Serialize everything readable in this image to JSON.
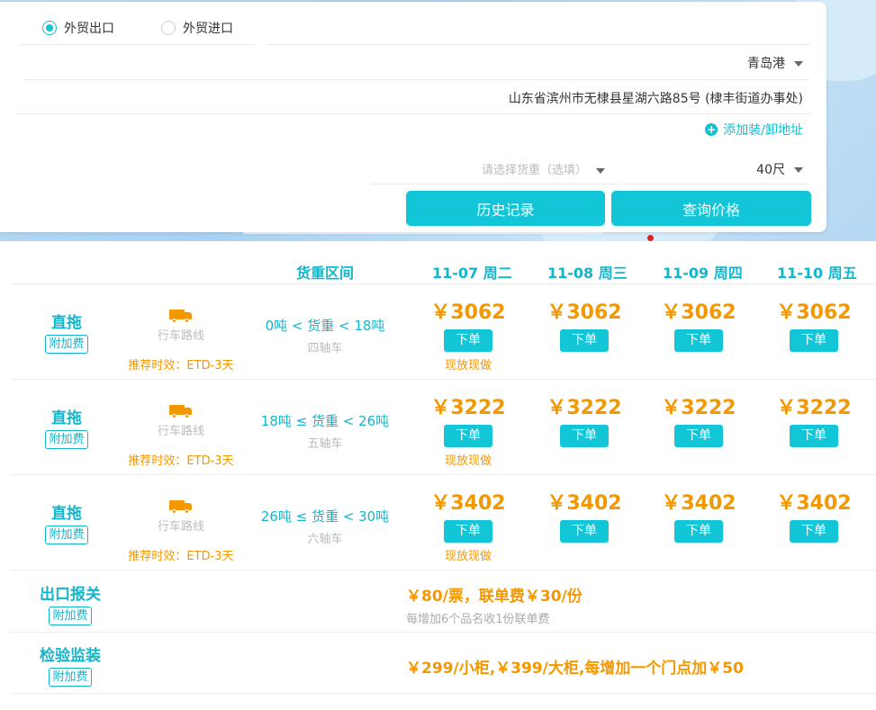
{
  "query": {
    "trade_type": [
      {
        "label": "外贸出口",
        "selected": true
      },
      {
        "label": "外贸进口",
        "selected": false
      }
    ],
    "port": "青岛港",
    "address": "山东省滨州市无棣县星湖六路85号 (棣丰街道办事处)",
    "add_address": "添加装/卸地址",
    "weight_placeholder": "请选择货重（选填）",
    "container": "40尺",
    "history_button": "历史记录",
    "search_button": "查询价格"
  },
  "table": {
    "weight_header": "货重区间",
    "dates": [
      "11-07 周二",
      "11-08 周三",
      "11-09 周四",
      "11-10 周五"
    ],
    "order_label": "下单",
    "rows": [
      {
        "service": "直拖",
        "tag": "附加费",
        "route": "行车路线",
        "eta": "推荐时效：ETD-3天",
        "weight_range": "0吨 < 货重 < 18吨",
        "axle": "四轴车",
        "prices": [
          "￥3062",
          "￥3062",
          "￥3062",
          "￥3062"
        ],
        "note": "现放现做"
      },
      {
        "service": "直拖",
        "tag": "附加费",
        "route": "行车路线",
        "eta": "推荐时效：ETD-3天",
        "weight_range": "18吨 ≤ 货重 < 26吨",
        "axle": "五轴车",
        "prices": [
          "￥3222",
          "￥3222",
          "￥3222",
          "￥3222"
        ],
        "note": "现放现做"
      },
      {
        "service": "直拖",
        "tag": "附加费",
        "route": "行车路线",
        "eta": "推荐时效：ETD-3天",
        "weight_range": "26吨 ≤ 货重 < 30吨",
        "axle": "六轴车",
        "prices": [
          "￥3402",
          "￥3402",
          "￥3402",
          "￥3402"
        ],
        "note": "现放现做"
      }
    ],
    "fees": [
      {
        "service": "出口报关",
        "tag": "附加费",
        "fee": "￥80/票，联单费￥30/份",
        "note": "每增加6个品名收1份联单费"
      },
      {
        "service": "检验监装",
        "tag": "附加费",
        "fee": "￥299/小柜,￥399/大柜,每增加一个门点加￥50",
        "note": ""
      }
    ]
  }
}
